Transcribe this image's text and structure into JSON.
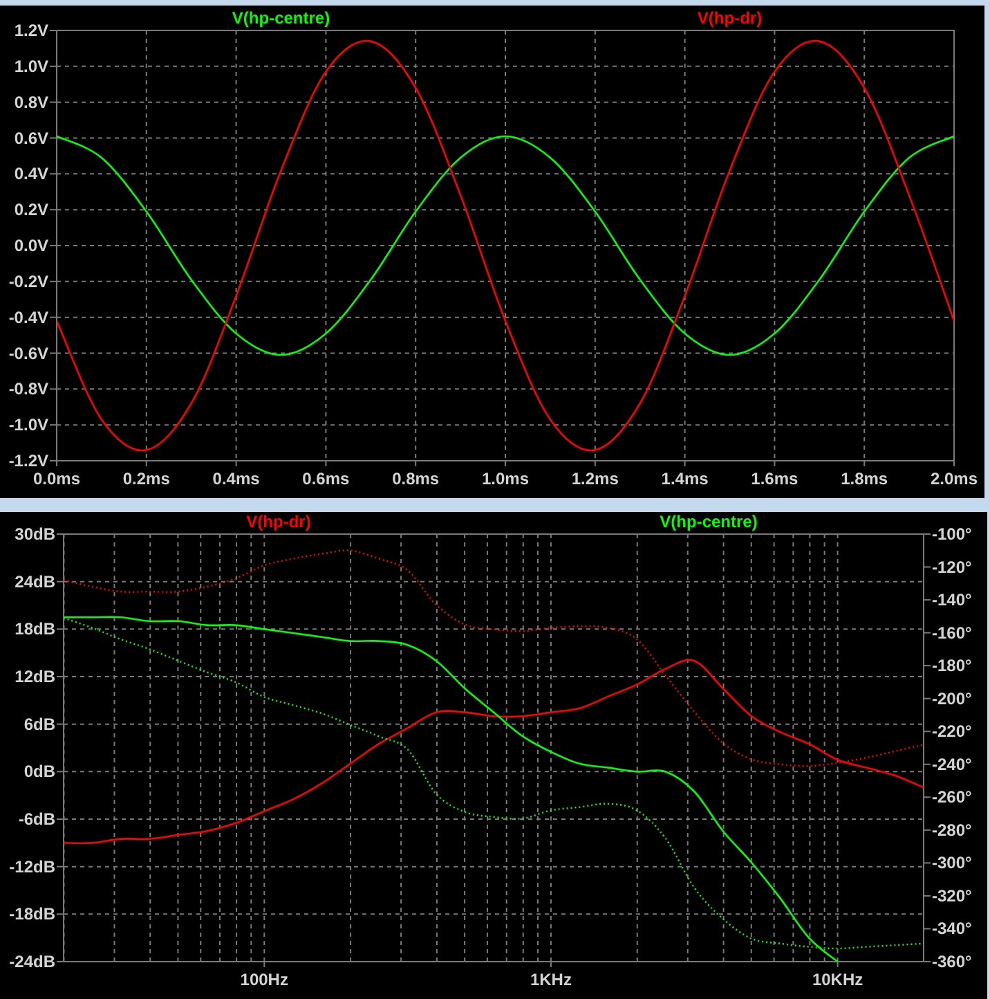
{
  "plots": [
    {
      "chart_data": {
        "type": "line",
        "grid": true,
        "x": [
          0,
          0.1,
          0.2,
          0.3,
          0.4,
          0.5,
          0.6,
          0.7,
          0.8,
          0.9,
          1.0,
          1.1,
          1.2,
          1.3,
          1.4,
          1.5,
          1.6,
          1.7,
          1.8,
          1.9,
          2.0
        ],
        "series": [
          {
            "name": "V(hp-centre)",
            "color": "#00ff00",
            "values": [
              0.61,
              0.49,
              0.19,
              -0.19,
              -0.49,
              -0.61,
              -0.49,
              -0.19,
              0.19,
              0.49,
              0.61,
              0.49,
              0.19,
              -0.19,
              -0.49,
              -0.61,
              -0.49,
              -0.19,
              0.19,
              0.49,
              0.61
            ]
          },
          {
            "name": "V(hp-dr)",
            "color": "#ff0000",
            "values": [
              -0.42,
              -0.97,
              -1.14,
              -0.88,
              -0.28,
              0.42,
              0.97,
              1.14,
              0.88,
              0.28,
              -0.42,
              -0.97,
              -1.14,
              -0.88,
              -0.28,
              0.42,
              0.97,
              1.14,
              0.88,
              0.28,
              -0.42
            ]
          }
        ],
        "xlim": [
          0,
          2
        ],
        "ylim": [
          -1.2,
          1.2
        ],
        "xticks": [
          {
            "value": 0,
            "label": "0.0ms"
          },
          {
            "value": 0.2,
            "label": "0.2ms"
          },
          {
            "value": 0.4,
            "label": "0.4ms"
          },
          {
            "value": 0.6,
            "label": "0.6ms"
          },
          {
            "value": 0.8,
            "label": "0.8ms"
          },
          {
            "value": 1.0,
            "label": "1.0ms"
          },
          {
            "value": 1.2,
            "label": "1.2ms"
          },
          {
            "value": 1.4,
            "label": "1.4ms"
          },
          {
            "value": 1.6,
            "label": "1.6ms"
          },
          {
            "value": 1.8,
            "label": "1.8ms"
          },
          {
            "value": 2.0,
            "label": "2.0ms"
          }
        ],
        "yticks": [
          {
            "value": 1.2,
            "label": "1.2V"
          },
          {
            "value": 1.0,
            "label": "1.0V"
          },
          {
            "value": 0.8,
            "label": "0.8V"
          },
          {
            "value": 0.6,
            "label": "0.6V"
          },
          {
            "value": 0.4,
            "label": "0.4V"
          },
          {
            "value": 0.2,
            "label": "0.2V"
          },
          {
            "value": 0,
            "label": "0.0V"
          },
          {
            "value": -0.2,
            "label": "-0.2V"
          },
          {
            "value": -0.4,
            "label": "-0.4V"
          },
          {
            "value": -0.6,
            "label": "-0.6V"
          },
          {
            "value": -0.8,
            "label": "-0.8V"
          },
          {
            "value": -1.0,
            "label": "-1.0V"
          },
          {
            "value": -1.2,
            "label": "-1.2V"
          }
        ]
      }
    },
    {
      "chart_data": {
        "type": "line",
        "grid": true,
        "categories": [
          null,
          null,
          null,
          null,
          null,
          null,
          null,
          "100Hz",
          null,
          null,
          null,
          null,
          null,
          null,
          null,
          null,
          null,
          "1KHz",
          null,
          null,
          null,
          null,
          null,
          null,
          null,
          null,
          null,
          "10KHz",
          null,
          null,
          null
        ],
        "series": [
          {
            "name": "V(hp-dr)",
            "color": "#ff0000",
            "values": [
              -9,
              -9,
              -8.5,
              -8.5,
              -8,
              -7.5,
              -6.5,
              -5,
              -3.5,
              -1.5,
              1,
              3.5,
              5.5,
              7.5,
              7.5,
              7,
              7,
              7.5,
              8,
              9.5,
              11,
              13,
              14,
              10.5,
              7,
              5,
              3.5,
              1.5,
              0.5,
              -0.5,
              -2
            ]
          },
          {
            "color": "#ff0000",
            "axis": "y2",
            "line_style": "dotted",
            "values": [
              -128,
              -132,
              -135,
              -135,
              -135,
              -132,
              -127,
              -119,
              -115,
              -112,
              -110,
              -115,
              -122,
              -143,
              -155,
              -158,
              -159,
              -157,
              -156,
              -157,
              -164,
              -186,
              -208,
              -227,
              -237,
              -240,
              -241,
              -239,
              -236,
              -232,
              -228
            ]
          },
          {
            "name": "V(hp-centre)",
            "color": "#00ff00",
            "values": [
              19.5,
              19.5,
              19.5,
              19,
              19,
              18.5,
              18.5,
              18,
              17.5,
              17,
              16.5,
              16.5,
              16,
              14,
              10.5,
              7.5,
              4.5,
              2.5,
              1,
              0.5,
              0,
              0,
              -2.5,
              -7.5,
              -11.5,
              -16,
              -21,
              -24,
              null,
              null,
              null
            ]
          },
          {
            "color": "#00ff00",
            "axis": "y2",
            "line_style": "dotted",
            "values": [
              -151,
              -157,
              -164,
              -170,
              -177,
              -184,
              -190,
              -199,
              -204,
              -209,
              -216,
              -223,
              -231,
              -258,
              -269,
              -272,
              -273,
              -268,
              -266,
              -264,
              -268,
              -285,
              -315,
              -334,
              -346,
              -349,
              -351,
              -352,
              -351,
              -350,
              -349
            ]
          }
        ],
        "ylim": [
          -24,
          30
        ],
        "y2lim": [
          -360,
          -100
        ],
        "yticks": [
          {
            "value": 30,
            "label": "30dB"
          },
          {
            "value": 24,
            "label": "24dB"
          },
          {
            "value": 18,
            "label": "18dB"
          },
          {
            "value": 12,
            "label": "12dB"
          },
          {
            "value": 6,
            "label": "6dB"
          },
          {
            "value": 0,
            "label": "0dB"
          },
          {
            "value": -6,
            "label": "-6dB"
          },
          {
            "value": -12,
            "label": "-12dB"
          },
          {
            "value": -18,
            "label": "-18dB"
          },
          {
            "value": -24,
            "label": "-24dB"
          }
        ],
        "y2ticks": [
          {
            "value": -100,
            "label": "-100°"
          },
          {
            "value": -120,
            "label": "-120°"
          },
          {
            "value": -140,
            "label": "-140°"
          },
          {
            "value": -160,
            "label": "-160°"
          },
          {
            "value": -180,
            "label": "-180°"
          },
          {
            "value": -200,
            "label": "-200°"
          },
          {
            "value": -220,
            "label": "-220°"
          },
          {
            "value": -240,
            "label": "-240°"
          },
          {
            "value": -260,
            "label": "-260°"
          },
          {
            "value": -280,
            "label": "-280°"
          },
          {
            "value": -300,
            "label": "-300°"
          },
          {
            "value": -320,
            "label": "-320°"
          },
          {
            "value": -340,
            "label": "-340°"
          },
          {
            "value": -360,
            "label": "-360°"
          }
        ]
      }
    }
  ]
}
